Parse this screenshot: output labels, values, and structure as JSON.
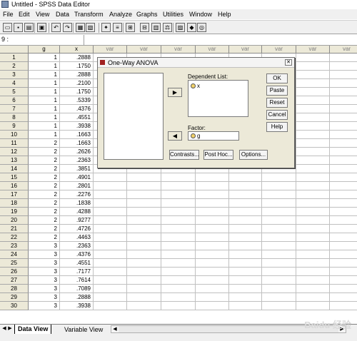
{
  "window": {
    "title": "Untitled - SPSS Data Editor"
  },
  "menu": [
    "File",
    "Edit",
    "View",
    "Data",
    "Transform",
    "Analyze",
    "Graphs",
    "Utilities",
    "Window",
    "Help"
  ],
  "toolbar_icons": [
    "open-icon",
    "save-icon",
    "print-icon",
    "dialog-recall-icon",
    "undo-icon",
    "redo-icon",
    "goto-chart-icon",
    "goto-case-icon",
    "find-icon",
    "variables-icon",
    "insert-case-icon",
    "insert-variable-icon",
    "split-file-icon",
    "weight-cases-icon",
    "select-cases-icon",
    "value-labels-icon",
    "use-sets-icon"
  ],
  "cell_editor": {
    "ref": "9 :"
  },
  "grid": {
    "columns": [
      "g",
      "x",
      "var",
      "var",
      "var",
      "var",
      "var",
      "var",
      "var",
      "var"
    ],
    "rows": [
      {
        "n": "1",
        "g": "1",
        "x": ".2888"
      },
      {
        "n": "2",
        "g": "1",
        "x": ".1750"
      },
      {
        "n": "3",
        "g": "1",
        "x": ".2888"
      },
      {
        "n": "4",
        "g": "1",
        "x": ".2100"
      },
      {
        "n": "5",
        "g": "1",
        "x": ".1750"
      },
      {
        "n": "6",
        "g": "1",
        "x": ".5339"
      },
      {
        "n": "7",
        "g": "1",
        "x": ".4376"
      },
      {
        "n": "8",
        "g": "1",
        "x": ".4551"
      },
      {
        "n": "9",
        "g": "1",
        "x": ".3938"
      },
      {
        "n": "10",
        "g": "1",
        "x": ".1663"
      },
      {
        "n": "11",
        "g": "2",
        "x": ".1663"
      },
      {
        "n": "12",
        "g": "2",
        "x": ".2626"
      },
      {
        "n": "13",
        "g": "2",
        "x": ".2363"
      },
      {
        "n": "14",
        "g": "2",
        "x": ".3851"
      },
      {
        "n": "15",
        "g": "2",
        "x": ".4901"
      },
      {
        "n": "16",
        "g": "2",
        "x": ".2801"
      },
      {
        "n": "17",
        "g": "2",
        "x": ".2276"
      },
      {
        "n": "18",
        "g": "2",
        "x": ".1838"
      },
      {
        "n": "19",
        "g": "2",
        "x": ".4288"
      },
      {
        "n": "20",
        "g": "2",
        "x": ".9277"
      },
      {
        "n": "21",
        "g": "2",
        "x": ".4726"
      },
      {
        "n": "22",
        "g": "2",
        "x": ".4463"
      },
      {
        "n": "23",
        "g": "3",
        "x": ".2363"
      },
      {
        "n": "24",
        "g": "3",
        "x": ".4376"
      },
      {
        "n": "25",
        "g": "3",
        "x": ".4551"
      },
      {
        "n": "26",
        "g": "3",
        "x": ".7177"
      },
      {
        "n": "27",
        "g": "3",
        "x": ".7614"
      },
      {
        "n": "28",
        "g": "3",
        "x": ".7089"
      },
      {
        "n": "29",
        "g": "3",
        "x": ".2888"
      },
      {
        "n": "30",
        "g": "3",
        "x": ".3938"
      }
    ]
  },
  "tabs": {
    "data_view": "Data View",
    "variable_view": "Variable View"
  },
  "dialog": {
    "title": "One-Way ANOVA",
    "dependent_label": "Dependent List:",
    "dependent_items": [
      "x"
    ],
    "factor_label": "Factor:",
    "factor_value": "g",
    "buttons": {
      "ok": "OK",
      "paste": "Paste",
      "reset": "Reset",
      "cancel": "Cancel",
      "help": "Help",
      "contrasts": "Contrasts...",
      "post_hoc": "Post Hoc...",
      "options": "Options..."
    }
  },
  "watermark": "Baidu 经验"
}
